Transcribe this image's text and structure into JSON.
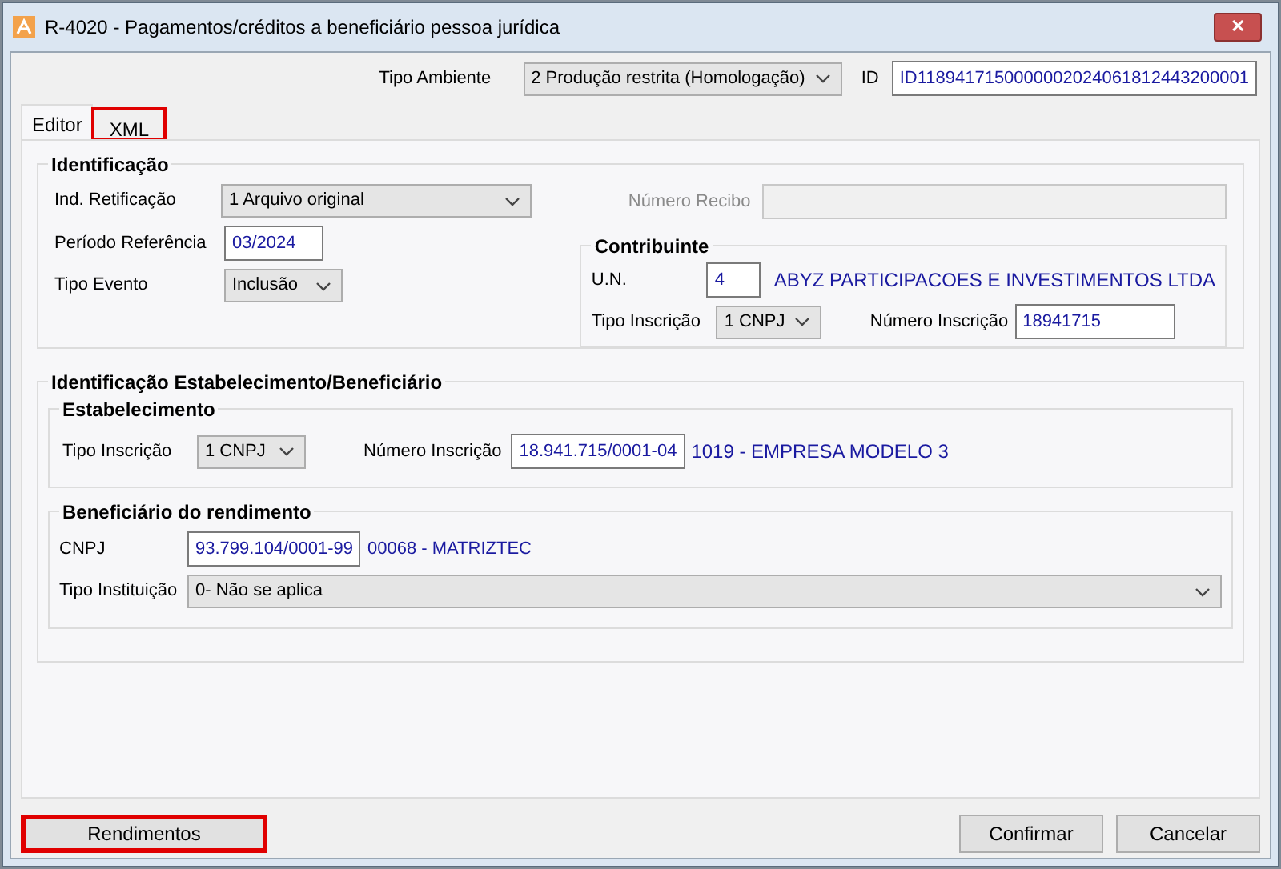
{
  "window": {
    "title": "R-4020 - Pagamentos/créditos a beneficiário pessoa jurídica",
    "close": "✕"
  },
  "header": {
    "tipo_ambiente": {
      "label": "Tipo Ambiente",
      "value": "2 Produção restrita (Homologação)"
    },
    "id": {
      "label": "ID",
      "value": "ID1189417150000002024061812443200001"
    }
  },
  "tabs": [
    {
      "label": "Editor",
      "selected": true,
      "highlighted": false
    },
    {
      "label": "XML",
      "selected": false,
      "highlighted": true
    }
  ],
  "identificacao": {
    "title": "Identificação",
    "ind_retificacao": {
      "label": "Ind. Retificação",
      "value": "1 Arquivo original"
    },
    "periodo": {
      "label": "Período Referência",
      "value": "03/2024"
    },
    "tipo_evento": {
      "label": "Tipo Evento",
      "value": "Inclusão"
    },
    "numero_recibo": {
      "label": "Número Recibo",
      "disabled": true
    },
    "contribuinte": {
      "title": "Contribuinte",
      "un_label": "U.N.",
      "un_value": "4",
      "un_name": "ABYZ PARTICIPACOES E INVESTIMENTOS LTDA",
      "tipo_label": "Tipo Inscrição",
      "tipo_value": "1 CNPJ",
      "numero_label": "Número Inscrição",
      "numero_value": "18941715"
    }
  },
  "estab_benef": {
    "title": "Identificação Estabelecimento/Beneficiário",
    "estabelecimento": {
      "title": "Estabelecimento",
      "tipo_label": "Tipo Inscrição",
      "tipo_value": "1 CNPJ",
      "numero_label": "Número Inscrição",
      "numero_value": "18.941.715/0001-04",
      "name": "1019 - EMPRESA MODELO 3"
    },
    "beneficiario": {
      "title": "Beneficiário do rendimento",
      "cnpj_label": "CNPJ",
      "cnpj_value": "93.799.104/0001-99",
      "name": "00068 - MATRIZTEC",
      "tipo_label": "Tipo Instituição",
      "tipo_value": "0- Não se aplica"
    }
  },
  "buttons": [
    {
      "label": "Rendimentos",
      "highlighted": true
    },
    {
      "label": "Confirmar",
      "highlighted": false
    },
    {
      "label": "Cancelar",
      "highlighted": false
    }
  ]
}
